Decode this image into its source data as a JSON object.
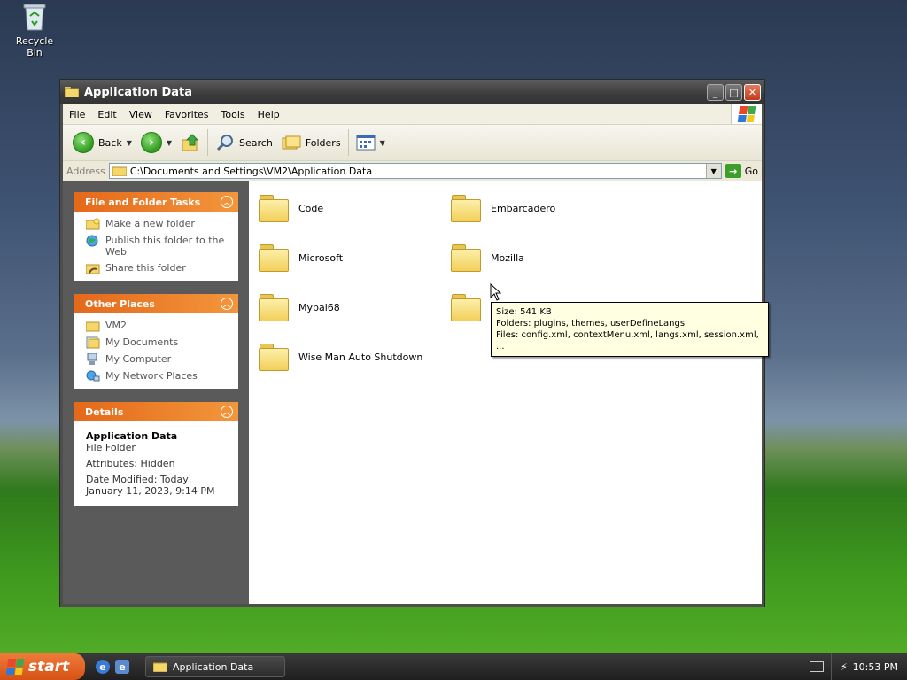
{
  "desktop": {
    "recycle_bin": "Recycle Bin"
  },
  "window": {
    "title": "Application Data",
    "menu": [
      "File",
      "Edit",
      "View",
      "Favorites",
      "Tools",
      "Help"
    ],
    "toolbar": {
      "back": "Back",
      "search": "Search",
      "folders": "Folders"
    },
    "address": {
      "label": "Address",
      "path": "C:\\Documents and Settings\\VM2\\Application Data",
      "go": "Go"
    }
  },
  "tasks_panel": {
    "title": "File and Folder Tasks",
    "items": [
      "Make a new folder",
      "Publish this folder to the Web",
      "Share this folder"
    ]
  },
  "places_panel": {
    "title": "Other Places",
    "items": [
      "VM2",
      "My Documents",
      "My Computer",
      "My Network Places"
    ]
  },
  "details_panel": {
    "title": "Details",
    "name": "Application Data",
    "type": "File Folder",
    "attributes": "Attributes: Hidden",
    "modified": "Date Modified: Today, January 11, 2023, 9:14 PM"
  },
  "folders": [
    "Code",
    "Embarcadero",
    "Microsoft",
    "Mozilla",
    "Mypal68",
    "",
    "Wise Man Auto Shutdown"
  ],
  "tooltip": {
    "size": "Size: 541 KB",
    "folders": "Folders: plugins, themes, userDefineLangs",
    "files": "Files: config.xml, contextMenu.xml, langs.xml, session.xml, ..."
  },
  "taskbar": {
    "start": "start",
    "task": "Application Data",
    "clock": "10:53 PM"
  },
  "colors": {
    "panel_header": "#e4691a",
    "start_button": "#d55214",
    "tooltip_bg": "#ffffe1"
  }
}
